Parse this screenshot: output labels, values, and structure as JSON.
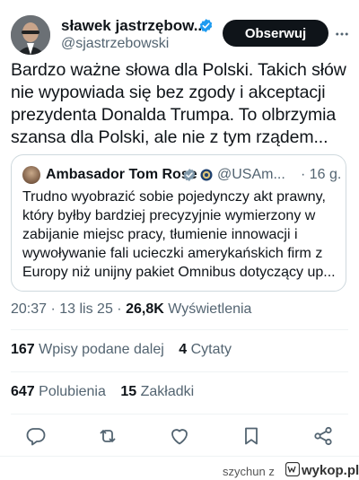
{
  "author": {
    "name": "sławek jastrzębow...",
    "handle": "@sjastrzebowski",
    "follow_label": "Obserwuj",
    "verified_color": "#1d9bf0"
  },
  "tweet": {
    "text": "Bardzo ważne słowa dla Polski. Takich słów nie wypowiada się bez zgody i akceptacji prezydenta Donalda Trumpa. To olbrzymia szansa dla Polski, ale nie z tym rządem..."
  },
  "quote": {
    "name": "Ambasador Tom Rose",
    "handle": "@USAm...",
    "time": "· 16 g.",
    "text": "Trudno wyobrazić sobie pojedynczy akt prawny, który byłby bardziej precyzyjnie wymierzony w zabijanie miejsc pracy, tłumienie innowacji i wywoływanie fali ucieczki amerykańskich firm z Europy niż unijny pakiet Omnibus dotyczący up..."
  },
  "meta": {
    "time_date": "20:37 · 13 lis 25 · ",
    "views_count": "26,8K",
    "views_label": "Wyświetlenia"
  },
  "stats": {
    "reposts_count": "167",
    "reposts_label": "Wpisy podane dalej",
    "quotes_count": "4",
    "quotes_label": "Cytaty",
    "likes_count": "647",
    "likes_label": "Polubienia",
    "bookmarks_count": "15",
    "bookmarks_label": "Zakładki"
  },
  "actions": {
    "icons": [
      "reply-icon",
      "repost-icon",
      "like-icon",
      "bookmark-icon",
      "share-icon"
    ],
    "color": "#536471"
  },
  "footer": {
    "user": "szychun",
    "connector": "z",
    "site": "wykop.pl"
  }
}
